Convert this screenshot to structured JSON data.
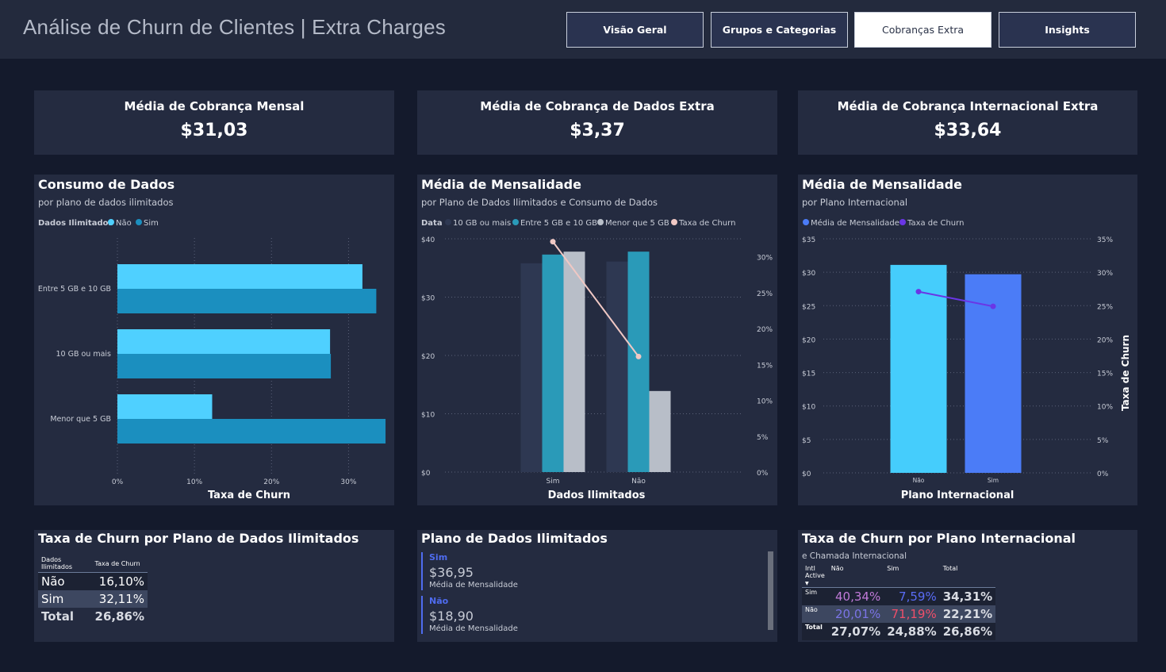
{
  "header": {
    "title": "Análise de Churn de Clientes | Extra Charges",
    "tabs": [
      {
        "label": "Visão Geral",
        "active": false
      },
      {
        "label": "Grupos e Categorias",
        "active": false
      },
      {
        "label": "Cobranças Extra",
        "active": true
      },
      {
        "label": "Insights",
        "active": false
      }
    ]
  },
  "kpis": [
    {
      "title": "Média de Cobrança Mensal",
      "value": "$31,03"
    },
    {
      "title": "Média de Cobrança de Dados Extra",
      "value": "$3,37"
    },
    {
      "title": "Média de Cobrança Internacional Extra",
      "value": "$33,64"
    }
  ],
  "charts": {
    "consumo": {
      "title": "Consumo de Dados",
      "subtitle": "por plano de dados ilimitados",
      "legend_title": "Dados Ilimitados",
      "legend": [
        "Não",
        "Sim"
      ]
    },
    "mensalidade": {
      "title": "Média de Mensalidade",
      "subtitle": "por Plano de Dados Ilimitados e Consumo de Dados",
      "legend_title": "Data",
      "legend": [
        "10 GB ou mais",
        "Entre 5 GB e 10 GB",
        "Menor que 5 GB",
        "Taxa de Churn"
      ]
    },
    "internacional": {
      "title": "Média de Mensalidade",
      "subtitle": "por Plano Internacional",
      "legend": [
        "Média de Mensalidade",
        "Taxa de Churn"
      ]
    }
  },
  "chart_data": [
    {
      "type": "bar",
      "orientation": "horizontal",
      "categories": [
        "Entre 5 GB e 10 GB",
        "10 GB ou mais",
        "Menor que 5 GB"
      ],
      "series": [
        {
          "name": "Não",
          "color": "#4fd0ff",
          "values": [
            31.8,
            27.6,
            12.3
          ]
        },
        {
          "name": "Sim",
          "color": "#1b8fbf",
          "values": [
            33.6,
            27.7,
            34.8
          ]
        }
      ],
      "xlabel": "Taxa de Churn",
      "xlim": [
        0,
        35
      ],
      "xticks": [
        "0%",
        "10%",
        "20%",
        "30%"
      ],
      "grid": true
    },
    {
      "type": "bar",
      "categories": [
        "Sim",
        "Não"
      ],
      "series": [
        {
          "name": "10 GB ou mais",
          "color": "#2e3852",
          "values": [
            35.8,
            36.1
          ]
        },
        {
          "name": "Entre 5 GB e 10 GB",
          "color": "#2a9ab8",
          "values": [
            37.3,
            37.8
          ]
        },
        {
          "name": "Menor que 5 GB",
          "color": "#b8bec8",
          "values": [
            37.8,
            13.9
          ]
        }
      ],
      "line": {
        "name": "Taxa de Churn",
        "color": "#f0c8c4",
        "values": [
          32.1,
          16.1
        ]
      },
      "xlabel": "Dados Ilimitados",
      "ylim": [
        0,
        40
      ],
      "yticks": [
        "$0",
        "$10",
        "$20",
        "$30",
        "$40"
      ],
      "y2lim": [
        0,
        32.5
      ],
      "y2ticks": [
        "0%",
        "5%",
        "10%",
        "15%",
        "20%",
        "25%",
        "30%"
      ],
      "grid": true
    },
    {
      "type": "bar",
      "categories": [
        "Não",
        "Sim"
      ],
      "series": [
        {
          "name": "Média de Mensalidade",
          "colors": [
            "#45cdfc",
            "#4b7cf7"
          ],
          "values": [
            31.1,
            29.7
          ]
        }
      ],
      "line": {
        "name": "Taxa de Churn",
        "color": "#6a36e6",
        "values": [
          27.1,
          24.9
        ]
      },
      "xlabel": "Plano Internacional",
      "y2label": "Taxa de Churn",
      "ylim": [
        0,
        35
      ],
      "yticks": [
        "$0",
        "$5",
        "$10",
        "$15",
        "$20",
        "$25",
        "$30",
        "$35"
      ],
      "y2lim": [
        0,
        35
      ],
      "y2ticks": [
        "0%",
        "5%",
        "10%",
        "15%",
        "20%",
        "25%",
        "30%",
        "35%"
      ],
      "grid": true
    }
  ],
  "table1": {
    "title": "Taxa de Churn por Plano de Dados Ilimitados",
    "headers": [
      "Dados Ilimitados",
      "Taxa de Churn"
    ],
    "rows": [
      [
        "Não",
        "16,10%"
      ],
      [
        "Sim",
        "32,11%"
      ]
    ],
    "total": [
      "Total",
      "26,86%"
    ]
  },
  "cards": {
    "title": "Plano de Dados Ilimitados",
    "items": [
      {
        "label": "Sim",
        "value": "$36,95",
        "caption": "Média de Mensalidade"
      },
      {
        "label": "Não",
        "value": "$18,90",
        "caption": "Média de Mensalidade"
      }
    ]
  },
  "table2": {
    "title": "Taxa de Churn por Plano Internacional",
    "subtitle": "e Chamada Internacional",
    "corner": "Intl Active",
    "headers": [
      "Não",
      "Sim",
      "Total"
    ],
    "rows": [
      {
        "label": "Sim",
        "values": [
          "40,34%",
          "7,59%",
          "34,31%"
        ],
        "colors": [
          "#c07ad8",
          "#5a6cf5",
          "#d8dbe2"
        ]
      },
      {
        "label": "Não",
        "values": [
          "20,01%",
          "71,19%",
          "22,21%"
        ],
        "colors": [
          "#7b74e6",
          "#f04f6a",
          "#d8dbe2"
        ]
      }
    ],
    "total": {
      "label": "Total",
      "values": [
        "27,07%",
        "24,88%",
        "26,86%"
      ]
    }
  }
}
